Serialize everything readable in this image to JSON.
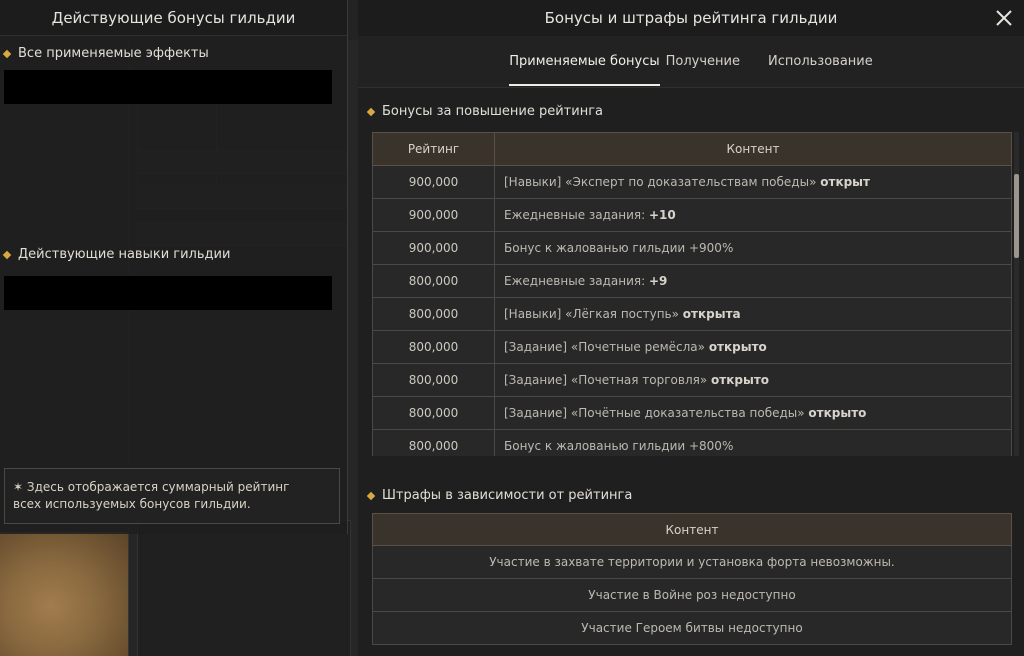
{
  "left_panel": {
    "title": "Действующие бонусы гильдии",
    "section_effects": "Все применяемые эффекты",
    "section_skills": "Действующие навыки гильдии",
    "note_line1": "✶ Здесь отображается суммарный рейтинг",
    "note_line2": "всех используемых бонусов гильдии."
  },
  "right_panel": {
    "title": "Бонусы и штрафы рейтинга гильдии",
    "tabs": [
      {
        "label": "Применяемые бонусы",
        "active": true
      },
      {
        "label": "Получение",
        "active": false
      },
      {
        "label": "Использование",
        "active": false
      }
    ],
    "bonus_section_title": "Бонусы за повышение рейтинга",
    "bonus_table": {
      "headers": [
        "Рейтинг",
        "Контент"
      ],
      "rows": [
        {
          "rating": "900,000",
          "pre": "[Навыки] «Эксперт по доказательствам победы» ",
          "bold": "открыт"
        },
        {
          "rating": "900,000",
          "pre": "Ежедневные задания: ",
          "bold": "+10"
        },
        {
          "rating": "900,000",
          "pre": "Бонус к жалованью гильдии +900%",
          "bold": ""
        },
        {
          "rating": "800,000",
          "pre": "Ежедневные задания: ",
          "bold": "+9"
        },
        {
          "rating": "800,000",
          "pre": "[Навыки] «Лёгкая поступь» ",
          "bold": "открыта"
        },
        {
          "rating": "800,000",
          "pre": "[Задание] «Почетные ремёсла» ",
          "bold": "открыто"
        },
        {
          "rating": "800,000",
          "pre": "[Задание] «Почетная торговля» ",
          "bold": "открыто"
        },
        {
          "rating": "800,000",
          "pre": "[Задание] «Почётные доказательства победы» ",
          "bold": "открыто"
        },
        {
          "rating": "800,000",
          "pre": "Бонус к жалованью гильдии +800%",
          "bold": ""
        }
      ]
    },
    "penalty_section_title": "Штрафы в зависимости от рейтинга",
    "penalty_table": {
      "header": "Контент",
      "rows": [
        "Участие в захвате территории и установка форта невозможны.",
        "Участие в Войне роз недоступно",
        "Участие Героем битвы недоступно"
      ]
    }
  },
  "colors": {
    "accent_diamond": "#d9a93f",
    "table_header_bg": "#3a332b"
  },
  "icons": [
    "close-icon",
    "diamond-bullet-icon"
  ]
}
